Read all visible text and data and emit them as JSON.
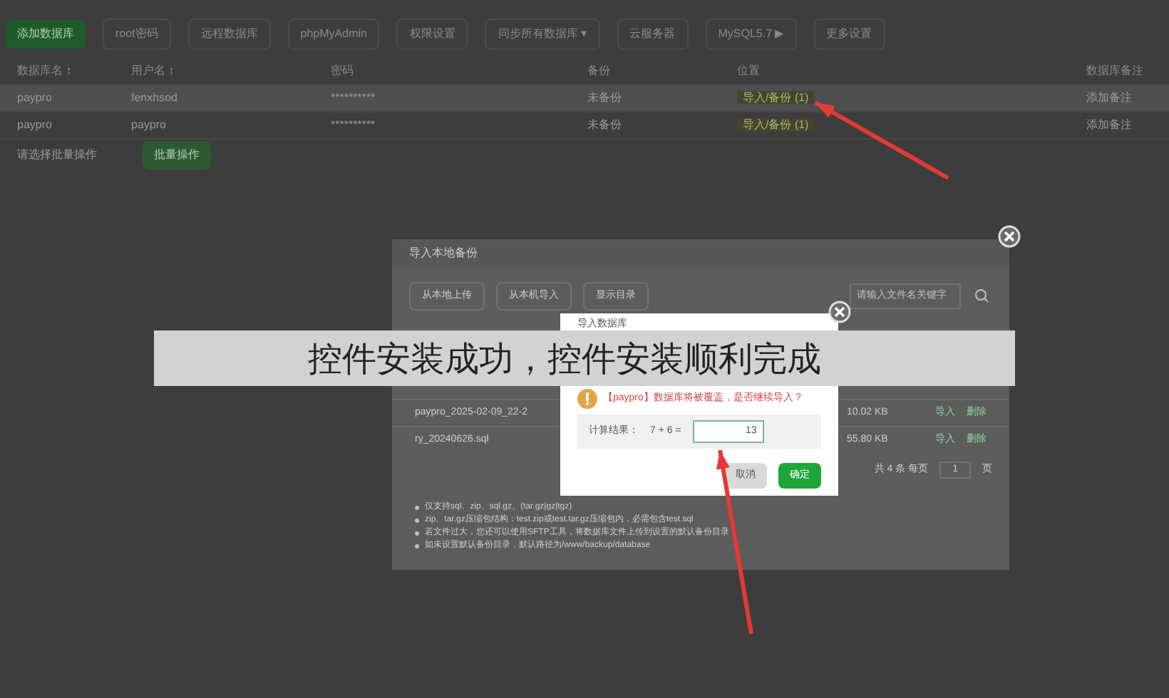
{
  "toolbar": [
    {
      "label": "添加数据库",
      "primary": true
    },
    {
      "label": "root密码",
      "primary": false
    },
    {
      "label": "远程数据库",
      "primary": false
    },
    {
      "label": "phpMyAdmin",
      "primary": false
    },
    {
      "label": "权限设置",
      "primary": false
    },
    {
      "label": "同步所有数据库 ▾",
      "primary": false
    },
    {
      "label": "云服务器",
      "primary": false
    },
    {
      "label": "MySQL5.7 ▶",
      "primary": false
    },
    {
      "label": "更多设置",
      "primary": false
    }
  ],
  "table": {
    "columns": [
      "数据库名 ↕",
      "用户名 ↕",
      "密码",
      "备份",
      "位置",
      "数据库备注"
    ],
    "rows": [
      {
        "cells": [
          "paypro",
          "fenxhsod",
          "**********",
          "未备份",
          "导入/备份 (1)",
          "添加备注"
        ],
        "highlighted": true
      },
      {
        "cells": [
          "paypro",
          "paypro",
          "**********",
          "未备份",
          "导入/备份 (1)",
          "添加备注"
        ],
        "highlighted": false
      }
    ],
    "footer": {
      "select": "请选择批量操作",
      "button": "批量操作"
    }
  },
  "import_dialog": {
    "title": "导入本地备份",
    "buttons": [
      "从本地上传",
      "从本机导入",
      "显示目录"
    ],
    "search": {
      "placeholder": "请输入文件名关键字"
    },
    "rows": [
      {
        "name": "paypro_2025-02-09_22-2",
        "size": "10.02 KB",
        "actions": [
          "导入",
          "删除"
        ]
      },
      {
        "name": "ry_20240626.sql",
        "size": "55.80 KB",
        "actions": [
          "导入",
          "删除"
        ]
      }
    ],
    "pagination": {
      "summary": "共 4 条 每页",
      "page": "1",
      "unit": "页"
    },
    "notes": [
      "仅支持sql、zip、sql.gz、(tar.gz|gz|tgz)",
      "zip、tar.gz压缩包结构：test.zip或test.tar.gz压缩包内，必需包含test.sql",
      "若文件过大，您还可以使用SFTP工具，将数据库文件上传到设置的默认备份目录",
      "如未设置默认备份目录，默认路径为/www/backup/database"
    ]
  },
  "confirm_dialog": {
    "title": "导入数据库",
    "warning": "【paypro】数据库将被覆盖，是否继续导入？",
    "calc_label": "计算结果：",
    "equation": "7 + 6 =",
    "answer": "13",
    "buttons": [
      {
        "label": "取消",
        "primary": false
      },
      {
        "label": "确定",
        "primary": true
      }
    ]
  },
  "caption_banner": "控件安装成功，控件安装顺利完成"
}
